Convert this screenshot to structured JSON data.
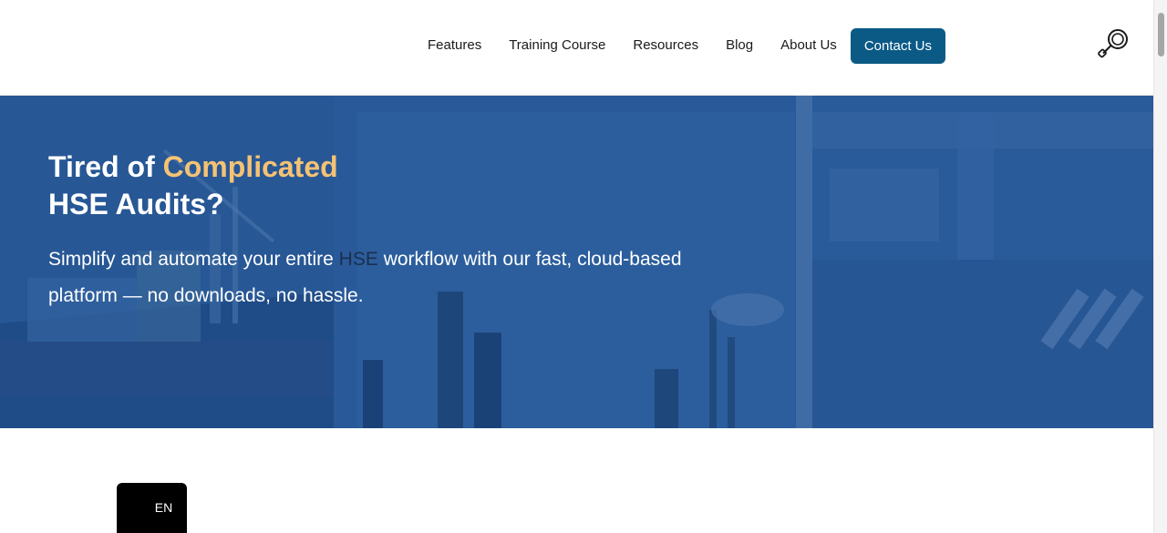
{
  "nav": {
    "items": [
      {
        "label": "Features"
      },
      {
        "label": "Training Course"
      },
      {
        "label": "Resources"
      },
      {
        "label": "Blog"
      },
      {
        "label": "About Us"
      }
    ],
    "contact_label": "Contact Us"
  },
  "header_icon": "search-icon",
  "hero": {
    "title_part1": "Tired of ",
    "title_accent": "Complicated",
    "title_line2": "HSE Audits?",
    "subtitle_before": "Simplify and automate your entire ",
    "subtitle_highlight": "HSE",
    "subtitle_after": " workflow with our fast, cloud-based platform — no downloads, no hassle."
  },
  "language": {
    "current": "EN"
  },
  "colors": {
    "brand_button": "#0b5a86",
    "hero_overlay": "#25558f",
    "accent": "#f5c274"
  }
}
